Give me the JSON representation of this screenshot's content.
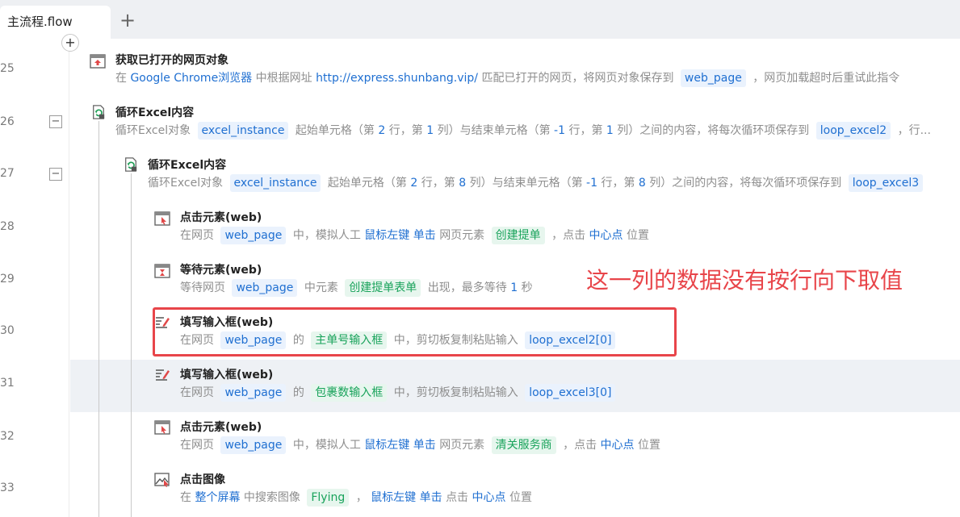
{
  "tabbar": {
    "active_tab": "主流程.flow",
    "add_tab": "+"
  },
  "gutter": {
    "add": "+",
    "fold": "−",
    "line_numbers": [
      "25",
      "26",
      "27",
      "28",
      "29",
      "30",
      "31",
      "32",
      "33"
    ]
  },
  "annotation": "这一列的数据没有按行向下取值",
  "steps": {
    "s25": {
      "title": "获取已打开的网页对象",
      "d0": "在",
      "d1": "Google Chrome浏览器",
      "d2": "中根据网址",
      "d3": "http://express.shunbang.vip/",
      "d4": "匹配已打开的网页，将网页对象保存到",
      "d5": "web_page",
      "d6": "，网页加载超时后重试此指令"
    },
    "s26": {
      "title": "循环Excel内容",
      "d0": "循环Excel对象",
      "d1": "excel_instance",
      "d2": "起始单元格（第",
      "d3": "2",
      "d4": "行，第",
      "d5": "1",
      "d6": "列）与结束单元格（第",
      "d7": "-1",
      "d8": "行，第",
      "d9": "1",
      "d10": "列）之间的内容，将每次循环项保存到",
      "d11": "loop_excel2",
      "d12": "，行..."
    },
    "s27": {
      "title": "循环Excel内容",
      "d0": "循环Excel对象",
      "d1": "excel_instance",
      "d2": "起始单元格（第",
      "d3": "2",
      "d4": "行，第",
      "d5": "8",
      "d6": "列）与结束单元格（第",
      "d7": "-1",
      "d8": "行，第",
      "d9": "8",
      "d10": "列）之间的内容，将每次循环项保存到",
      "d11": "loop_excel3"
    },
    "s28": {
      "title": "点击元素(web)",
      "d0": "在网页",
      "d1": "web_page",
      "d2": "中，模拟人工",
      "d3": "鼠标左键",
      "d4": "单击",
      "d5": "网页元素",
      "d6": "创建提单",
      "d7": "，点击",
      "d8": "中心点",
      "d9": "位置"
    },
    "s29": {
      "title": "等待元素(web)",
      "d0": "等待网页",
      "d1": "web_page",
      "d2": "中元素",
      "d3": "创建提单表单",
      "d4": "出现，最多等待",
      "d5": "1",
      "d6": "秒"
    },
    "s30": {
      "title": "填写输入框(web)",
      "d0": "在网页",
      "d1": "web_page",
      "d2": "的",
      "d3": "主单号输入框",
      "d4": "中，剪切板复制粘贴输入",
      "d5": "loop_excel2[0]"
    },
    "s31": {
      "title": "填写输入框(web)",
      "d0": "在网页",
      "d1": "web_page",
      "d2": "的",
      "d3": "包裹数输入框",
      "d4": "中，剪切板复制粘贴输入",
      "d5": "loop_excel3[0]"
    },
    "s32": {
      "title": "点击元素(web)",
      "d0": "在网页",
      "d1": "web_page",
      "d2": "中，模拟人工",
      "d3": "鼠标左键",
      "d4": "单击",
      "d5": "网页元素",
      "d6": "清关服务商",
      "d7": "，点击",
      "d8": "中心点",
      "d9": "位置"
    },
    "s33": {
      "title": "点击图像",
      "d0": "在",
      "d1": "整个屏幕",
      "d2": "中搜索图像",
      "d3": "Flying",
      "d4": "，",
      "d5": "鼠标左键",
      "d6": "单击",
      "d7": "点击",
      "d8": "中心点",
      "d9": "位置"
    }
  }
}
